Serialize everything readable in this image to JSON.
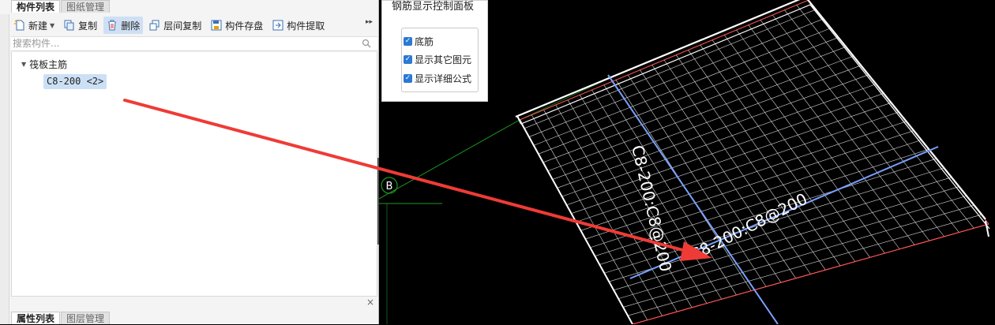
{
  "top_tabs": [
    {
      "label": "构件列表",
      "active": true
    },
    {
      "label": "图纸管理",
      "active": false
    }
  ],
  "toolbar": {
    "new_label": "新建",
    "copy_label": "复制",
    "delete_label": "删除",
    "floor_copy_label": "层间复制",
    "save_label": "构件存盘",
    "extract_label": "构件提取",
    "more_glyph": "▸▸"
  },
  "search": {
    "placeholder": "搜索构件..."
  },
  "tree": {
    "root_label": "筏板主筋",
    "child_label": "C8-200 <2>"
  },
  "splitter": {
    "close_glyph": "×"
  },
  "bottom_tabs": [
    {
      "label": "属性列表",
      "active": true
    },
    {
      "label": "图层管理",
      "active": false
    }
  ],
  "control_panel": {
    "title": "钢筋显示控制面板",
    "options": [
      {
        "label": "底筋",
        "checked": true
      },
      {
        "label": "显示其它图元",
        "checked": true
      },
      {
        "label": "显示详细公式",
        "checked": true
      }
    ]
  },
  "viewport": {
    "axis_label": "B",
    "rebar_label_vertical": "C8-200:C8@200",
    "rebar_label_horizontal": "C8-200:C8@200",
    "colors": {
      "background": "#000000",
      "slab_edge": "#ffffff",
      "grid": "#ffffff",
      "rebar_line": "#7aa0ff",
      "red_edge": "#ff5555",
      "axis_green": "#1c9a1c",
      "arrow": "#ef3b36"
    }
  }
}
